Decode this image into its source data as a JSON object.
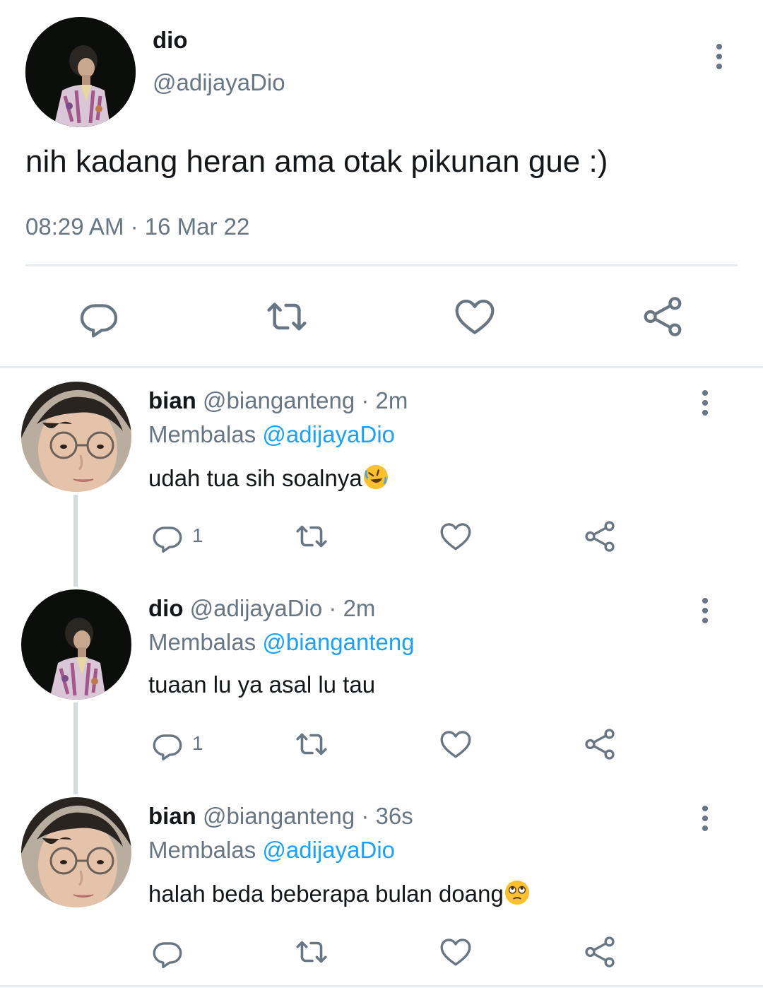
{
  "main_tweet": {
    "name": "dio",
    "handle": "@adijayaDio",
    "text": "nih kadang heran ama otak pikunan gue :)",
    "timestamp": "08:29 AM · 16 Mar 22",
    "avatar": "dio-avatar",
    "actions": [
      "reply-icon",
      "retweet-icon",
      "like-icon",
      "share-icon"
    ]
  },
  "replies": [
    {
      "name": "bian",
      "handle_time": "@bianganteng · 2m",
      "replying_label": "Membalas",
      "replying_to": "@adijayaDio",
      "text": "udah tua sih soalnya",
      "emoji": "rolling-on-floor-laughing-emoji",
      "reply_count": "1",
      "avatar": "bian-avatar"
    },
    {
      "name": "dio",
      "handle_time": "@adijayaDio · 2m",
      "replying_label": "Membalas",
      "replying_to": "@bianganteng",
      "text": "tuaan lu ya asal lu tau",
      "emoji": "",
      "reply_count": "1",
      "avatar": "dio-avatar"
    },
    {
      "name": "bian",
      "handle_time": "@bianganteng · 36s",
      "replying_label": "Membalas",
      "replying_to": "@adijayaDio",
      "text": "halah beda beberapa bulan doang",
      "emoji": "eye-roll-emoji",
      "reply_count": "",
      "avatar": "bian-avatar"
    }
  ],
  "colors": {
    "text": "#14171a",
    "secondary": "#687684",
    "mention": "#1da1f2",
    "divider": "#e6ecf0",
    "thread_line": "#d3dbe1"
  }
}
